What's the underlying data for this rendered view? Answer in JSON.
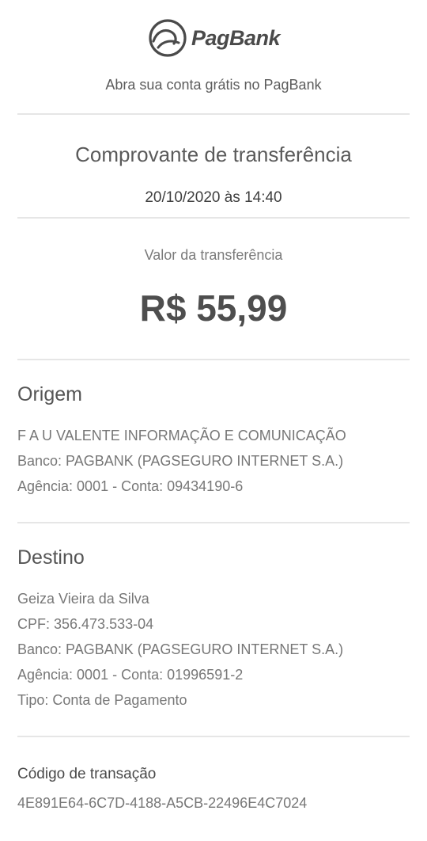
{
  "header": {
    "brand": "PagBank",
    "logo_icon": "pagbank-logo-icon",
    "tagline": "Abra sua conta grátis no PagBank"
  },
  "receipt": {
    "title": "Comprovante de transferência",
    "datetime": "20/10/2020 às 14:40",
    "amount_label": "Valor da transferência",
    "amount_value": "R$ 55,99"
  },
  "origin": {
    "heading": "Origem",
    "name": "F A U VALENTE INFORMAÇÃO E COMUNICAÇÃO",
    "bank": "Banco: PAGBANK (PAGSEGURO INTERNET S.A.)",
    "account": "Agência: 0001 - Conta: 09434190-6"
  },
  "destination": {
    "heading": "Destino",
    "name": "Geiza Vieira da Silva",
    "cpf": "CPF: 356.473.533-04",
    "bank": "Banco: PAGBANK (PAGSEGURO INTERNET S.A.)",
    "account": "Agência: 0001 - Conta: 01996591-2",
    "type": "Tipo: Conta de Pagamento"
  },
  "transaction": {
    "label": "Código de transação",
    "code": "4E891E64-6C7D-4188-A5CB-22496E4C7024"
  }
}
